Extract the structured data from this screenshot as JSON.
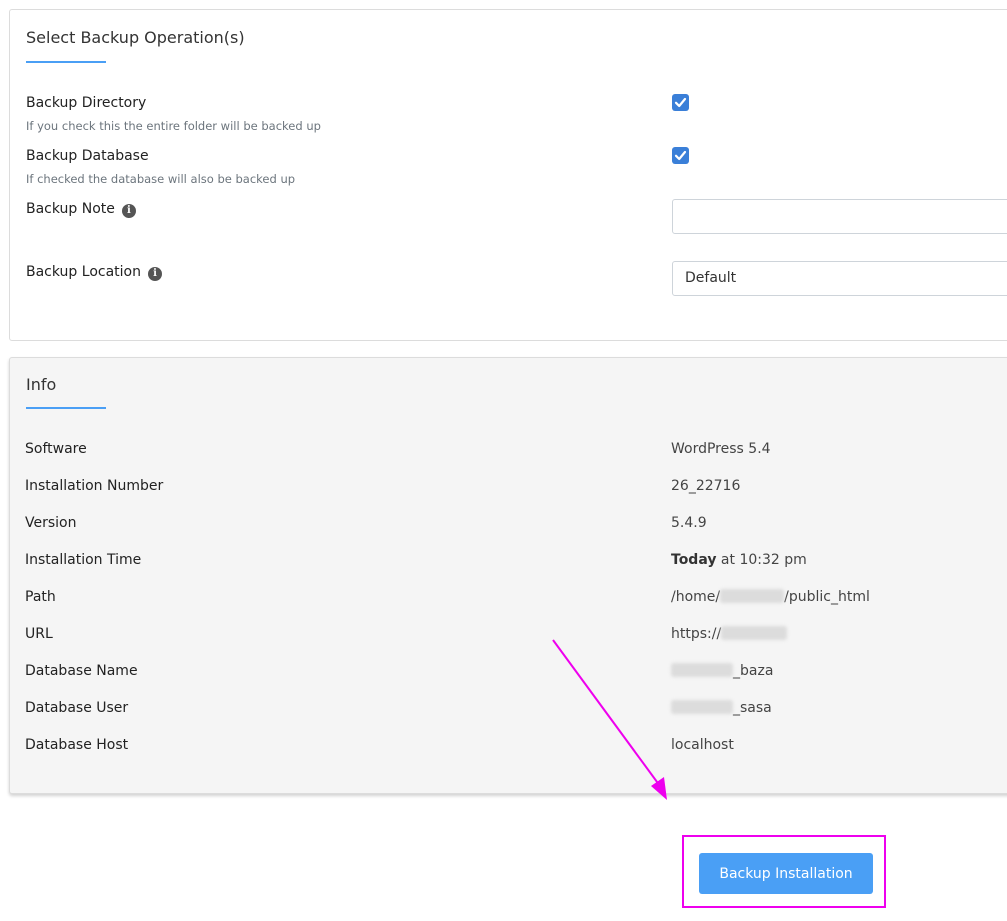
{
  "operations": {
    "title": "Select Backup Operation(s)",
    "backup_directory": {
      "label": "Backup Directory",
      "help": "If you check this the entire folder will be backed up",
      "checked": true
    },
    "backup_database": {
      "label": "Backup Database",
      "help": "If checked the database will also be backed up",
      "checked": true
    },
    "backup_note": {
      "label": "Backup Note",
      "value": "",
      "placeholder": ""
    },
    "backup_location": {
      "label": "Backup Location",
      "value": "Default"
    }
  },
  "info": {
    "title": "Info",
    "rows": [
      {
        "label": "Software",
        "value": "WordPress 5.4"
      },
      {
        "label": "Installation Number",
        "value": "26_22716"
      },
      {
        "label": "Version",
        "value": "5.4.9"
      },
      {
        "label": "Installation Time",
        "value_bold": "Today",
        "value_rest": " at 10:32 pm"
      },
      {
        "label": "Path",
        "value_prefix": "/home/",
        "value_suffix": "/public_html"
      },
      {
        "label": "URL",
        "value_prefix": "https://",
        "value_suffix": ""
      },
      {
        "label": "Database Name",
        "value_prefix": "",
        "value_suffix": "_baza"
      },
      {
        "label": "Database User",
        "value_prefix": "",
        "value_suffix": "_sasa"
      },
      {
        "label": "Database Host",
        "value": "localhost"
      }
    ]
  },
  "actions": {
    "backup_button": "Backup Installation"
  },
  "colors": {
    "accent": "#4a9ff5",
    "checkbox": "#3a7fd8",
    "annotation": "#ee00ee",
    "info_background": "#f5f5f5"
  }
}
